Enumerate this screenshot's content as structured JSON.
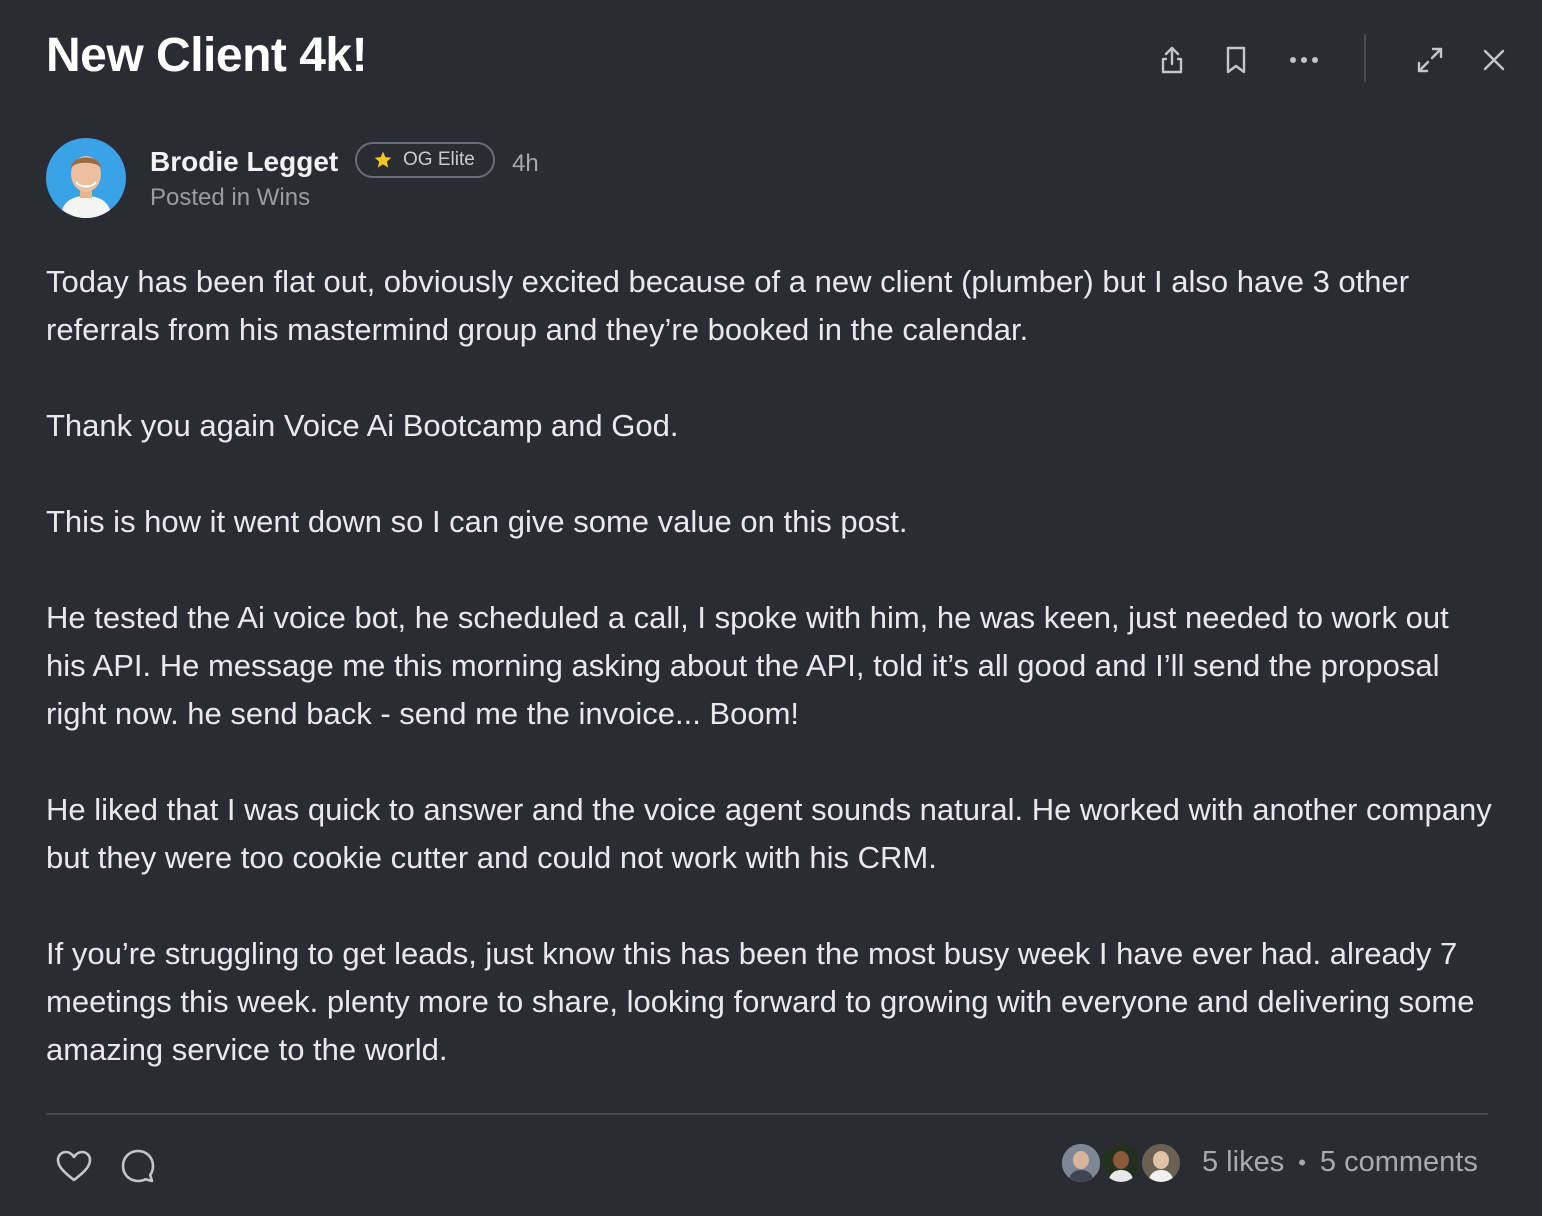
{
  "post": {
    "title": "New Client 4k!",
    "author": {
      "name": "Brodie Legget",
      "badge": "OG Elite",
      "time": "4h",
      "posted_prefix": "Posted in",
      "category": "Wins"
    },
    "paragraphs": [
      "Today has been flat out, obviously excited because of a new client (plumber) but I also have 3 other referrals from his mastermind group and they’re booked in the calendar.",
      "Thank you again Voice Ai Bootcamp and God.",
      "This is how it went down so I can give some value on this post.",
      "He tested the Ai voice bot, he scheduled a call, I spoke with him, he was keen, just needed to work out his API. He message me this morning asking about the API, told it’s all good and I’ll send the proposal right now. he send back - send me the invoice... Boom!",
      "He liked that I was quick to answer and the voice agent sounds natural. He worked with another company but they were too cookie cutter and could not work with his CRM.",
      "If you’re struggling to get leads, just know this has been the most busy week I have ever had. already 7 meetings this week. plenty more to share, looking forward to growing with everyone and delivering some amazing service to the world."
    ],
    "likes_label": "5 likes",
    "comments_label": "5 comments"
  },
  "icons": {
    "share": "share-icon",
    "bookmark": "bookmark-icon",
    "more": "more-icon",
    "expand": "expand-icon",
    "close": "close-icon",
    "star": "star-icon",
    "heart": "heart-icon",
    "comment": "comment-icon"
  },
  "colors": {
    "background": "#2b2c33",
    "badge_star": "#f5c518",
    "avatar_bg": "#3aa3e8"
  }
}
